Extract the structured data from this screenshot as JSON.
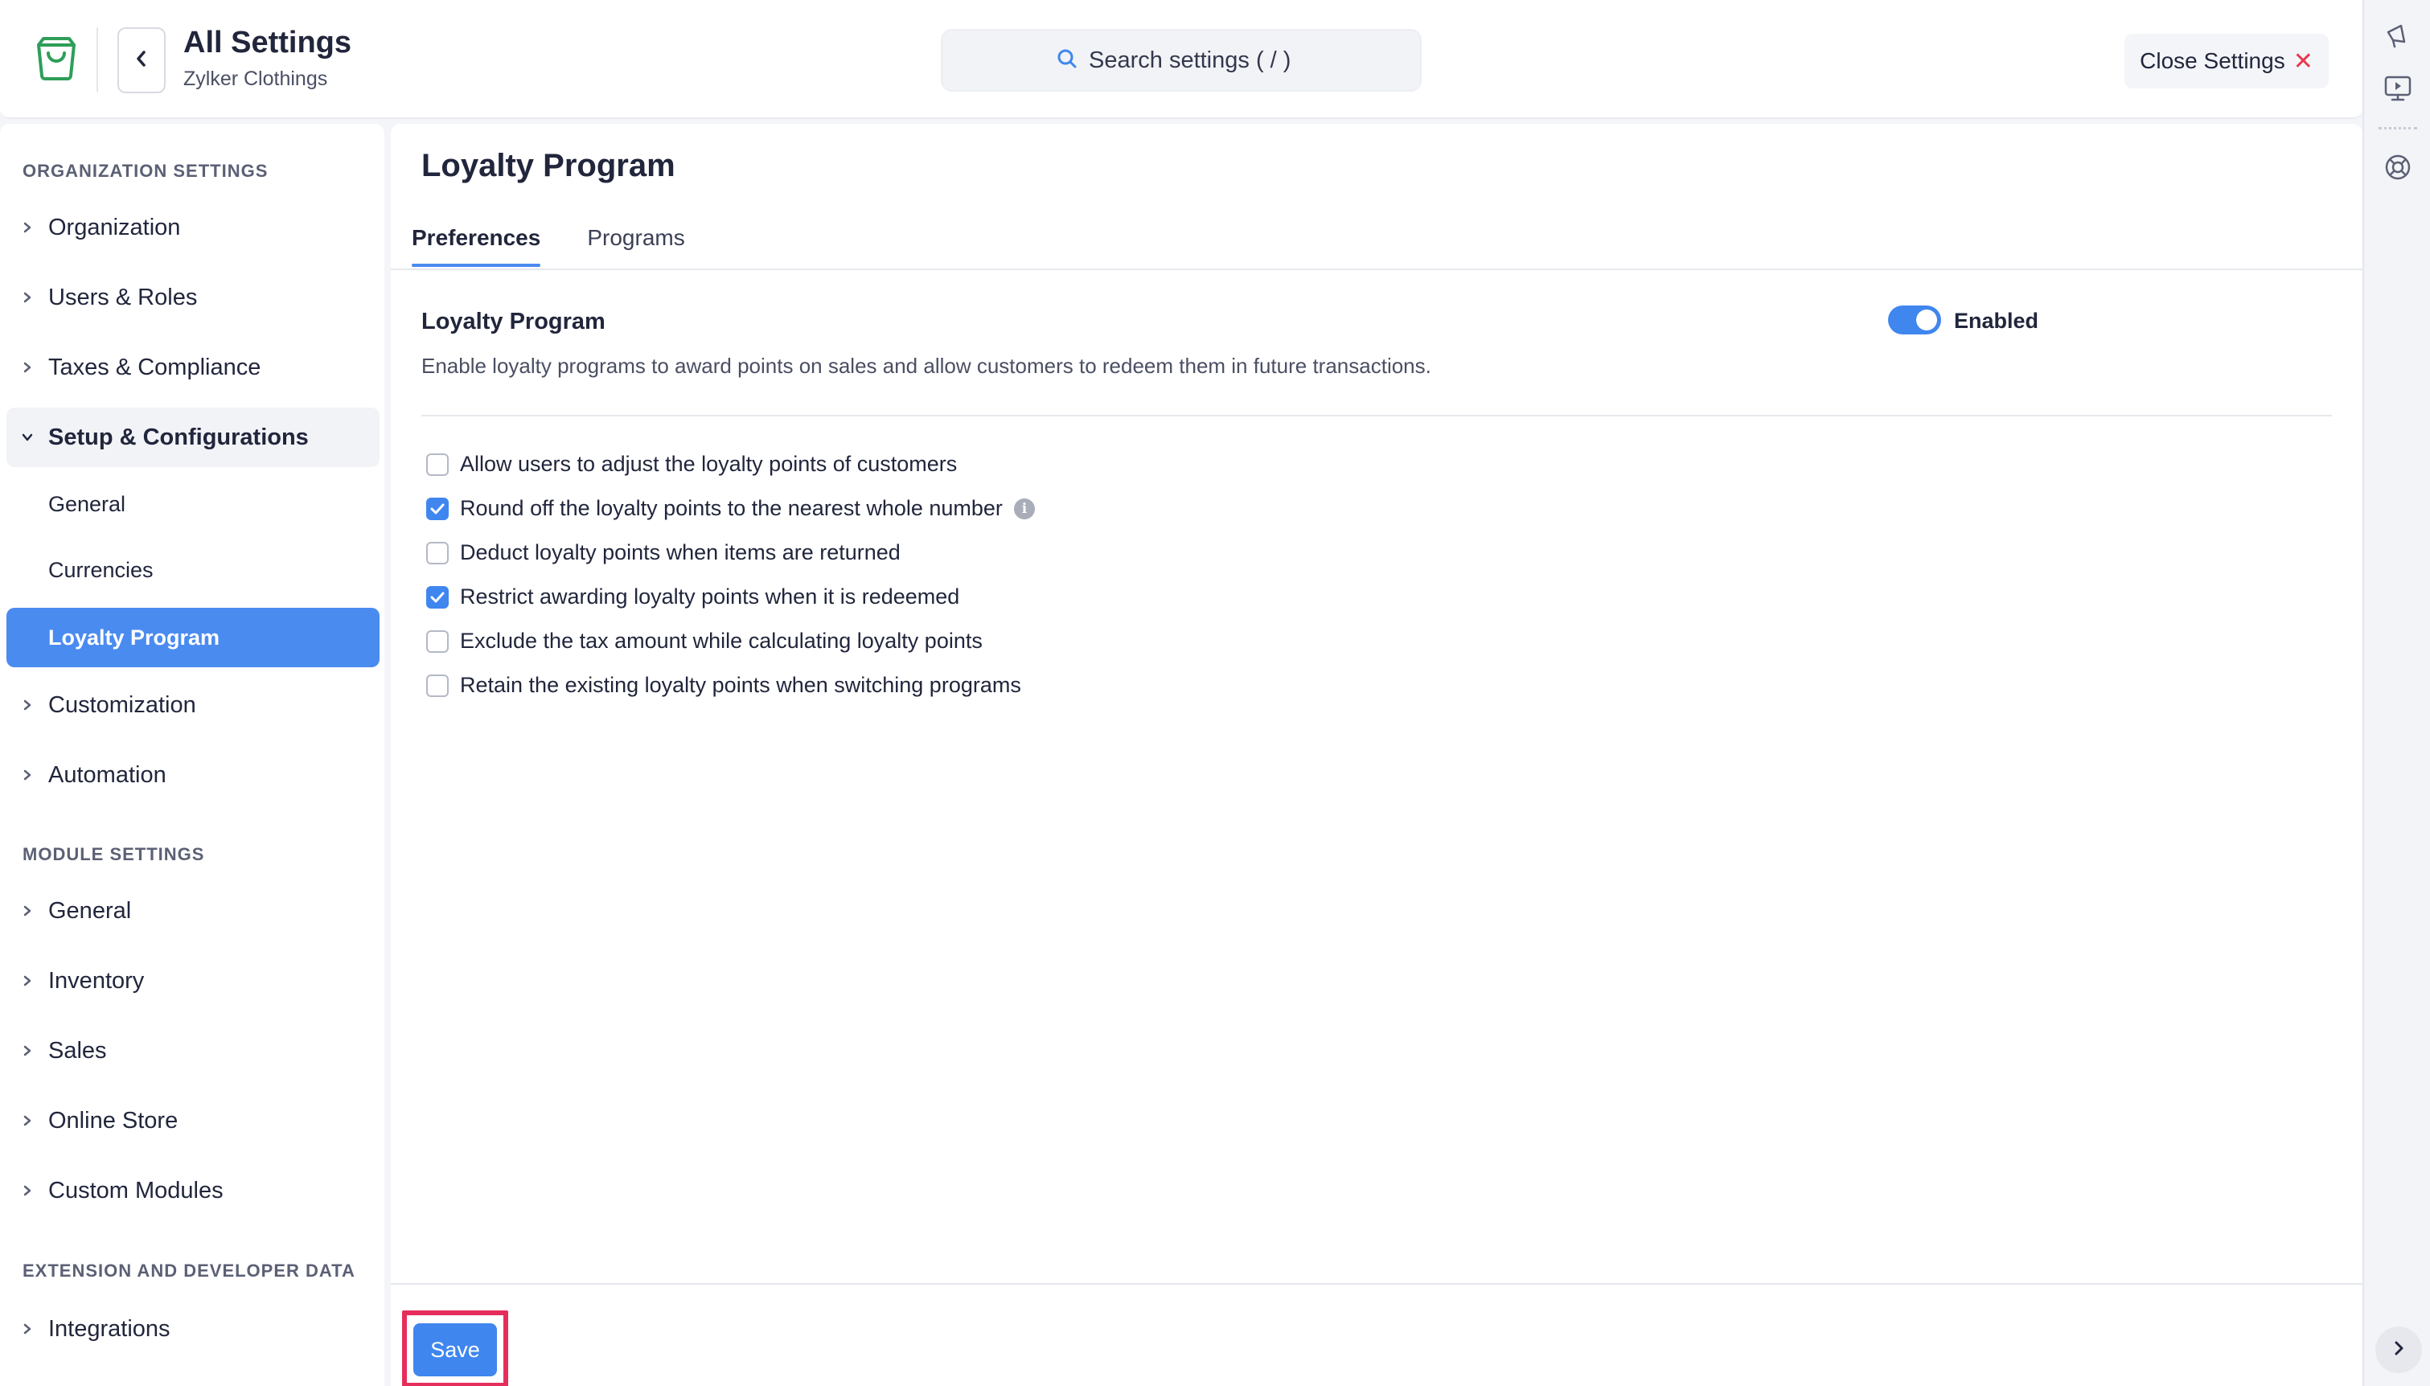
{
  "header": {
    "title": "All Settings",
    "subtitle": "Zylker Clothings",
    "search_placeholder": "Search settings ( / )",
    "close_label": "Close Settings",
    "close_glyph": "✕"
  },
  "sidebar": {
    "org_section_label": "ORGANIZATION SETTINGS",
    "org_items": [
      {
        "label": "Organization"
      },
      {
        "label": "Users & Roles"
      },
      {
        "label": "Taxes & Compliance"
      },
      {
        "label": "Setup & Configurations"
      }
    ],
    "setup_subitems": [
      {
        "label": "General"
      },
      {
        "label": "Currencies"
      },
      {
        "label": "Loyalty Program"
      }
    ],
    "org_items_after": [
      {
        "label": "Customization"
      },
      {
        "label": "Automation"
      }
    ],
    "module_section_label": "MODULE SETTINGS",
    "module_items": [
      {
        "label": "General"
      },
      {
        "label": "Inventory"
      },
      {
        "label": "Sales"
      },
      {
        "label": "Online Store"
      },
      {
        "label": "Custom Modules"
      }
    ],
    "ext_section_label": "EXTENSION AND DEVELOPER DATA",
    "ext_items": [
      {
        "label": "Integrations"
      }
    ],
    "active_item": "Loyalty Program"
  },
  "main": {
    "page_title": "Loyalty Program",
    "tabs": [
      {
        "label": "Preferences",
        "active": true
      },
      {
        "label": "Programs",
        "active": false
      }
    ],
    "preference": {
      "title": "Loyalty Program",
      "description": "Enable loyalty programs to award points on sales and allow customers to redeem them in future transactions.",
      "toggle_label": "Enabled",
      "toggle_on": true
    },
    "options": [
      {
        "label": "Allow users to adjust the loyalty points of customers",
        "checked": false
      },
      {
        "label": "Round off the loyalty points to the nearest whole number",
        "checked": true,
        "info": true
      },
      {
        "label": "Deduct loyalty points when items are returned",
        "checked": false
      },
      {
        "label": "Restrict awarding loyalty points when it is redeemed",
        "checked": true
      },
      {
        "label": "Exclude the tax amount while calculating loyalty points",
        "checked": false
      },
      {
        "label": "Retain the existing loyalty points when switching programs",
        "checked": false
      }
    ],
    "info_glyph": "i",
    "save_label": "Save"
  },
  "colors": {
    "accent": "#3f86ef",
    "active_nav": "#4a8bf0",
    "close_x": "#e8384f",
    "highlight": "#e62e5c"
  },
  "icons": {
    "logo": "shopping-bag-icon",
    "back": "chevron-left-icon",
    "search": "search-icon",
    "rail": [
      "megaphone-icon",
      "video-tutorial-icon",
      "help-lifebuoy-icon",
      "chevron-right-icon"
    ]
  }
}
